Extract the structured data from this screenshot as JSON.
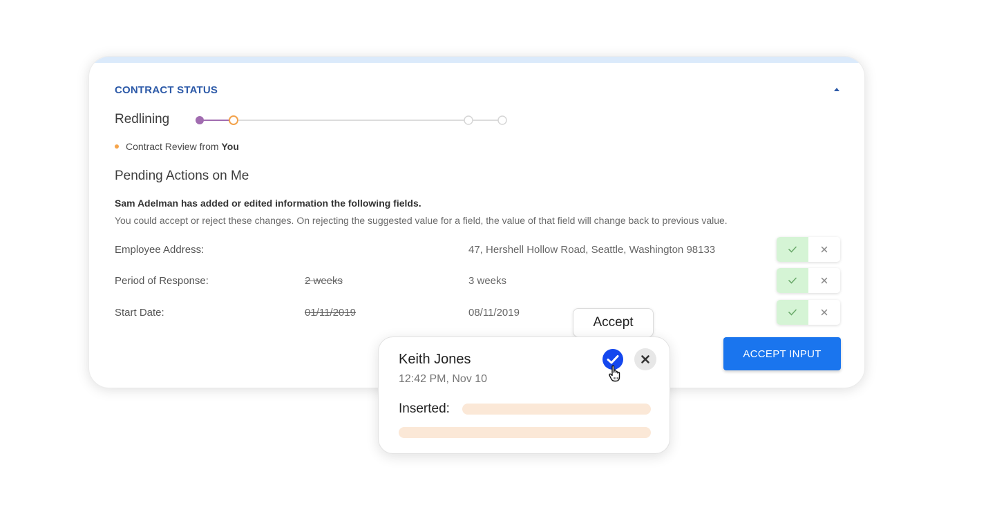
{
  "contract_status": {
    "title": "CONTRACT STATUS",
    "collapse_icon": "chevron-up-icon",
    "stage": "Redlining",
    "progress": {
      "steps": 4,
      "completed": 1,
      "current": 2,
      "colors": {
        "completed": "#a16cb0",
        "current": "#f3a24a",
        "pending": "#d6d6d6"
      }
    },
    "step_caption": "Contract Review from",
    "step_owner": "You"
  },
  "pending": {
    "heading": "Pending Actions on Me",
    "summary": "Sam Adelman has added or edited information the following fields.",
    "note": "You could accept or reject these changes. On rejecting the suggested value for a field, the value of that field will change back to previous value.",
    "fields": [
      {
        "label": "Employee Address:",
        "old": "",
        "new": "47,  Hershell Hollow Road, Seattle, Washington 98133"
      },
      {
        "label": "Period of Response:",
        "old": "2 weeks",
        "new": "3 weeks"
      },
      {
        "label": "Start Date:",
        "old": "01/11/2019",
        "new": "08/11/2019"
      }
    ],
    "accept_icon": "check-icon",
    "reject_icon": "close-icon",
    "accept_input_label": "ACCEPT INPUT"
  },
  "tooltip": {
    "label": "Accept"
  },
  "comment": {
    "author": "Keith Jones",
    "time": "12:42 PM, Nov 10",
    "inserted_label": "Inserted:",
    "accept_icon": "check-circle-icon",
    "reject_icon": "close-icon",
    "cursor_icon": "hand-pointer-icon"
  },
  "colors": {
    "accent": "#1a75ee",
    "title_blue": "#2d5aa8",
    "accept_green_bg": "#d5f4d5",
    "inserted_highlight": "#fbe8d7"
  }
}
